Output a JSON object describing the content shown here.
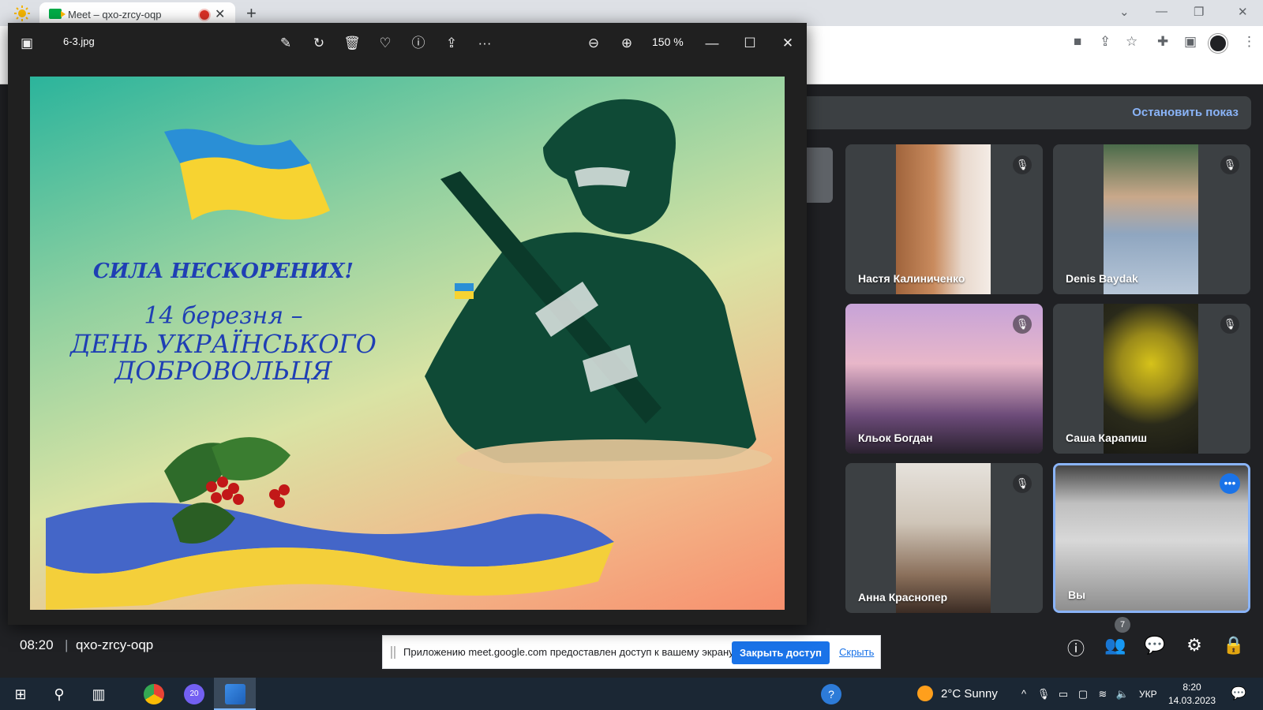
{
  "browser": {
    "tab_title": "Meet – qxo-zrcy-oqp",
    "new_tab": "+",
    "window_controls": [
      "—",
      "❐",
      "✕"
    ]
  },
  "meet": {
    "stop_presenting": "Остановить показ",
    "participants": [
      {
        "name": "Настя Калиниченко",
        "muted": true
      },
      {
        "name": "Denis Baydak",
        "muted": true
      },
      {
        "name": "Кльок Богдан",
        "muted": true
      },
      {
        "name": "Саша Карапиш",
        "muted": true
      },
      {
        "name": "Анна Краснопер",
        "muted": true
      },
      {
        "name": "Вы",
        "muted": false
      }
    ],
    "time": "08:20",
    "meeting_code": "qxo-zrcy-oqp",
    "people_count": "7",
    "share_notice": {
      "message": "Приложению meet.google.com предоставлен доступ к вашему экрану.",
      "stop_button": "Закрыть доступ",
      "hide_link": "Скрыть"
    }
  },
  "viewer": {
    "filename": "6-3.jpg",
    "zoom": "150 %",
    "poster": {
      "line1": "СИЛА НЕСКОРЕНИХ!",
      "line2": "14 березня –",
      "line3": "ДЕНЬ УКРАЇНСЬКОГО",
      "line4": "ДОБРОВОЛЬЦЯ"
    }
  },
  "taskbar": {
    "weather": "2°C  Sunny",
    "language": "УКР",
    "time": "8:20",
    "date": "14.03.2023",
    "viber_badge": "20"
  },
  "colors": {
    "accent": "#1a73e8",
    "link": "#8ab4f8",
    "record": "#d93025",
    "poster_text": "#1f3fb4"
  }
}
